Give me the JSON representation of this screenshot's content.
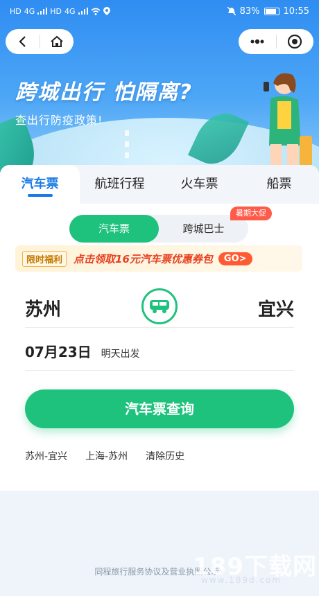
{
  "statusbar": {
    "sim1": "HD",
    "sim2": "HD",
    "net1": "4G",
    "net2": "4G",
    "battery": "83%",
    "time": "10:55"
  },
  "hero": {
    "title": "跨城出行 怕隔离?",
    "subtitle": "查出行防疫政策!"
  },
  "tabs": [
    {
      "label": "汽车票"
    },
    {
      "label": "航班行程"
    },
    {
      "label": "火车票"
    },
    {
      "label": "船票"
    }
  ],
  "segment": {
    "options": [
      {
        "label": "汽车票"
      },
      {
        "label": "跨城巴士"
      }
    ],
    "badge": "暑期大促"
  },
  "promo": {
    "tag": "限时福利",
    "text": "点击领取16元汽车票优惠券包",
    "go": "GO>"
  },
  "route": {
    "from": "苏州",
    "to": "宜兴"
  },
  "date": {
    "value": "07月23日",
    "note": "明天出发"
  },
  "search_button": "汽车票查询",
  "history": [
    "苏州-宜兴",
    "上海-苏州",
    "清除历史"
  ],
  "footer": "同程旅行服务协议及营业执照公示»",
  "watermark": {
    "main": "189下载网",
    "sub": "www.189d.com"
  },
  "colors": {
    "primary_green": "#1ec27d",
    "tab_blue": "#1a7be6",
    "promo_red": "#e8401f"
  }
}
